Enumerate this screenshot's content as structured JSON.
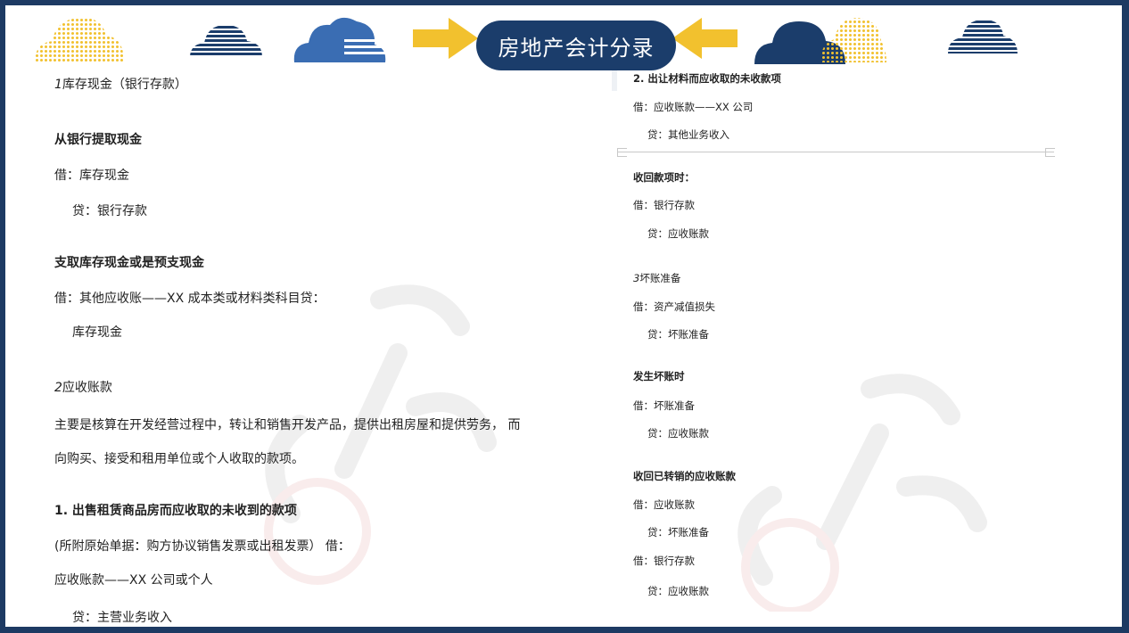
{
  "header": {
    "title": "房地产会计分录"
  },
  "colors": {
    "navy": "#1b3d6b",
    "blue": "#3a6db3",
    "gold": "#f2c12e",
    "frame": "#1d3a63"
  },
  "left": {
    "l1_num": "1",
    "l1_text": "库存现金（银行存款）",
    "l2": "从银行提取现金",
    "l3": "借：库存现金",
    "l4": "贷：银行存款",
    "l5": "支取库存现金或是预支现金",
    "l6": "借：其他应收账——XX 成本类或材料类科目贷：",
    "l7": "库存现金",
    "l8_num": "2",
    "l8_text": "应收账款",
    "l9": "主要是核算在开发经营过程中，转让和销售开发产品，提供出租房屋和提供劳务， 而",
    "l10": "向购买、接受和租用单位或个人收取的款项。",
    "l11": "1. 出售租赁商品房而应收取的未收到的款项",
    "l12": "(所附原始单据：购方协议销售发票或出租发票）  借：",
    "l13": "应收账款——XX 公司或个人",
    "l14": "贷：主营业务收入"
  },
  "right": {
    "r1": "2. 出让材料而应收取的未收款项",
    "r2": "借：应收账款——XX 公司",
    "r3": "贷：其他业务收入",
    "r4": "收回款项时：",
    "r5": "借：银行存款",
    "r6": "贷：应收账款",
    "r7_num": "3",
    "r7_text": "坏账准备",
    "r8": "借：资产减值损失",
    "r9": "贷：坏账准备",
    "r10": "发生坏账时",
    "r11": "借：坏账准备",
    "r12": "贷：应收账款",
    "r13": "收回已转销的应收账款",
    "r14": "借：应收账款",
    "r15": "贷：坏账准备",
    "r16": "借：银行存款",
    "r17": "贷：应收账款"
  }
}
